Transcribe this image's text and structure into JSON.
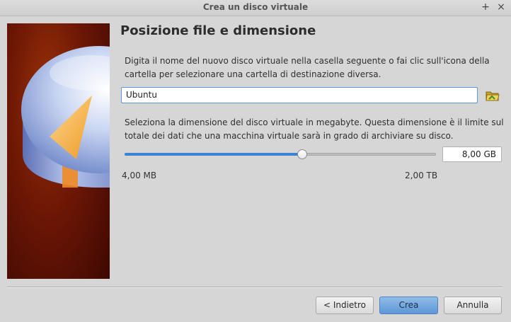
{
  "window": {
    "title": "Crea un disco virtuale"
  },
  "page": {
    "heading": "Posizione file e dimensione"
  },
  "location": {
    "description": "Digita il nome del nuovo disco virtuale nella casella seguente o fai clic sull'icona della cartella per selezionare una cartella di destinazione diversa.",
    "value": "Ubuntu"
  },
  "size": {
    "description": "Seleziona la dimensione del disco virtuale in megabyte. Questa dimensione è il limite sul totale dei dati che una macchina virtuale sarà in grado di archiviare su disco.",
    "value": "8,00 GB",
    "min_label": "4,00 MB",
    "max_label": "2,00 TB",
    "slider_fraction": 0.57
  },
  "buttons": {
    "back": "< Indietro",
    "create": "Crea",
    "cancel": "Annulla"
  },
  "colors": {
    "accent": "#3d83d4",
    "side_banner": "#6d1705"
  }
}
